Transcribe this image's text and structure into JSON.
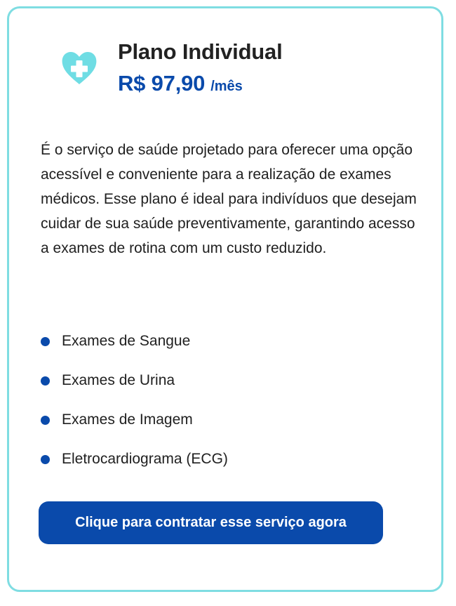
{
  "plan": {
    "title": "Plano Individual",
    "price": "R$ 97,90",
    "period": "/mês",
    "description": "É o serviço de saúde projetado para oferecer uma opção acessível e conveniente para a realização de exames médicos. Esse plano é ideal para indivíduos que desejam cuidar de sua saúde preventivamente, garantindo acesso a exames de rotina com um custo reduzido.",
    "features": [
      "Exames de Sangue",
      "Exames de Urina",
      "Exames de Imagem",
      "Eletrocardiograma (ECG)"
    ],
    "cta_label": "Clique para contratar esse serviço agora",
    "icon": "heart-plus-icon"
  },
  "colors": {
    "accent": "#0a4aab",
    "card_border": "#7fdde2",
    "icon": "#6fdde4"
  }
}
